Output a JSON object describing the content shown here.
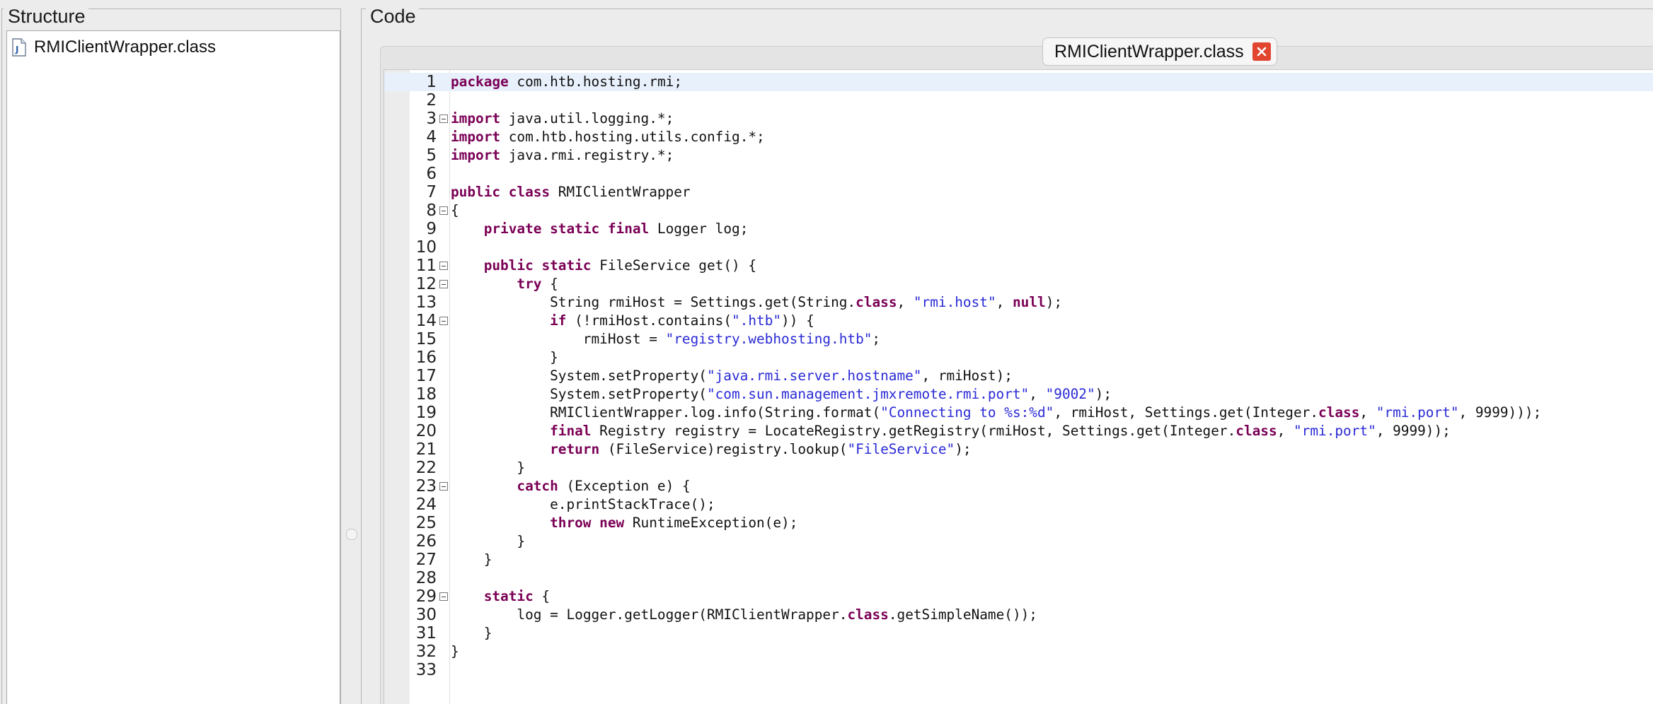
{
  "panels": {
    "structure_title": "Structure",
    "code_title": "Code"
  },
  "structure": {
    "items": [
      {
        "label": "RMIClientWrapper.class",
        "icon": "java-class-file-icon"
      }
    ]
  },
  "editor": {
    "tab_label": "RMIClientWrapper.class",
    "current_line": 1,
    "fold_lines": [
      3,
      8,
      11,
      12,
      14,
      23,
      29
    ],
    "lines": [
      "package com.htb.hosting.rmi;",
      "",
      "import java.util.logging.*;",
      "import com.htb.hosting.utils.config.*;",
      "import java.rmi.registry.*;",
      "",
      "public class RMIClientWrapper",
      "{",
      "    private static final Logger log;",
      "",
      "    public static FileService get() {",
      "        try {",
      "            String rmiHost = Settings.get(String.class, \"rmi.host\", null);",
      "            if (!rmiHost.contains(\".htb\")) {",
      "                rmiHost = \"registry.webhosting.htb\";",
      "            }",
      "            System.setProperty(\"java.rmi.server.hostname\", rmiHost);",
      "            System.setProperty(\"com.sun.management.jmxremote.rmi.port\", \"9002\");",
      "            RMIClientWrapper.log.info(String.format(\"Connecting to %s:%d\", rmiHost, Settings.get(Integer.class, \"rmi.port\", 9999)));",
      "            final Registry registry = LocateRegistry.getRegistry(rmiHost, Settings.get(Integer.class, \"rmi.port\", 9999));",
      "            return (FileService)registry.lookup(\"FileService\");",
      "        }",
      "        catch (Exception e) {",
      "            e.printStackTrace();",
      "            throw new RuntimeException(e);",
      "        }",
      "    }",
      "",
      "    static {",
      "        log = Logger.getLogger(RMIClientWrapper.class.getSimpleName());",
      "    }",
      "}",
      ""
    ],
    "keywords": [
      "package",
      "import",
      "public",
      "class",
      "private",
      "static",
      "final",
      "try",
      "if",
      "catch",
      "throw",
      "new",
      "return",
      "null"
    ],
    "colors": {
      "keyword": "#7a0055",
      "string": "#2a2ad6",
      "current_line": "#e8f0fb"
    }
  }
}
